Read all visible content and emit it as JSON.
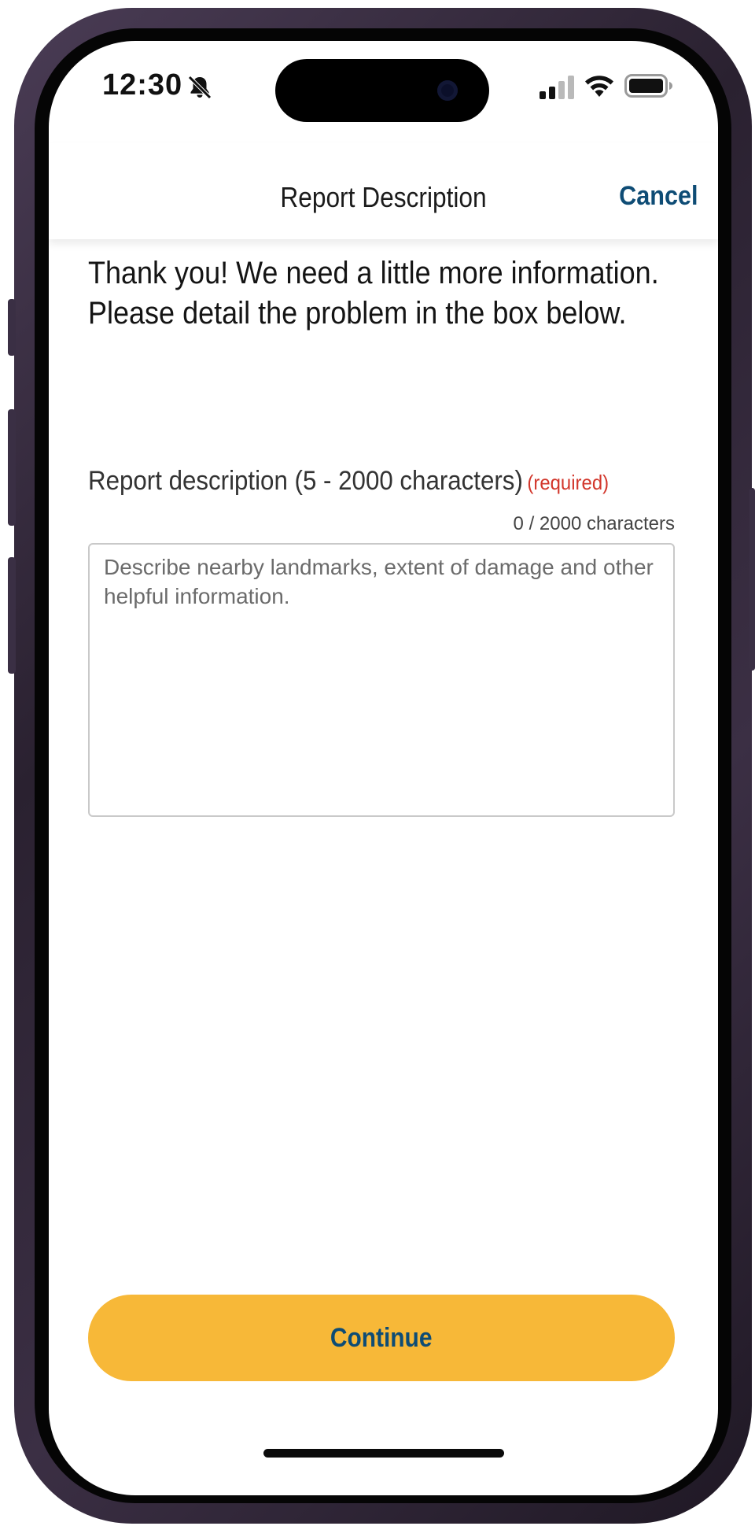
{
  "status_bar": {
    "time": "12:30",
    "icons": [
      "bell-slash-icon",
      "cellular-signal-icon",
      "wifi-icon",
      "battery-icon"
    ]
  },
  "navbar": {
    "title": "Report Description",
    "cancel_label": "Cancel"
  },
  "form": {
    "intro": "Thank you! We need a little more information. Please detail the problem in the box below.",
    "label": "Report description (5 - 2000 characters)",
    "required_tag": "(required)",
    "counter": "0 / 2000 characters",
    "description_value": "",
    "description_placeholder": "Describe nearby landmarks, extent of damage and other helpful information."
  },
  "actions": {
    "continue_label": "Continue"
  },
  "colors": {
    "accent_blue": "#0e4c75",
    "button_yellow": "#f7b838",
    "required_red": "#d2362b"
  }
}
